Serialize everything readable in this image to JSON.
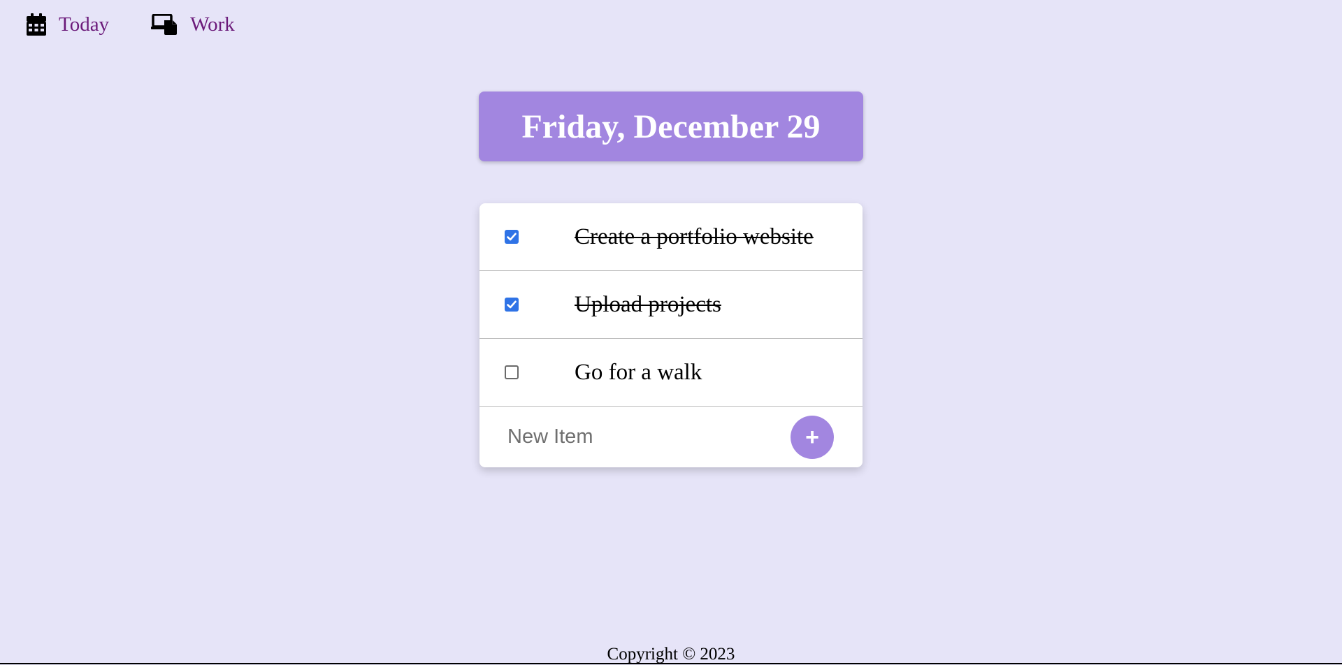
{
  "nav": {
    "items": [
      {
        "label": "Today",
        "icon": "calendar-icon"
      },
      {
        "label": "Work",
        "icon": "devices-icon"
      }
    ],
    "link_color": "#6B1A7A"
  },
  "heading": {
    "title": "Friday, December 29",
    "background": "#A286E0"
  },
  "todo": {
    "items": [
      {
        "text": "Create a portfolio website",
        "checked": true
      },
      {
        "text": "Upload projects",
        "checked": true
      },
      {
        "text": "Go for a walk",
        "checked": false
      }
    ],
    "new_item": {
      "placeholder": "New Item",
      "value": ""
    },
    "add_button_label": "+"
  },
  "footer": {
    "text": "Copyright © 2023"
  },
  "colors": {
    "page_background": "#E6E4F8",
    "accent": "#A286E0",
    "checkbox_checked": "#2F73E6"
  }
}
